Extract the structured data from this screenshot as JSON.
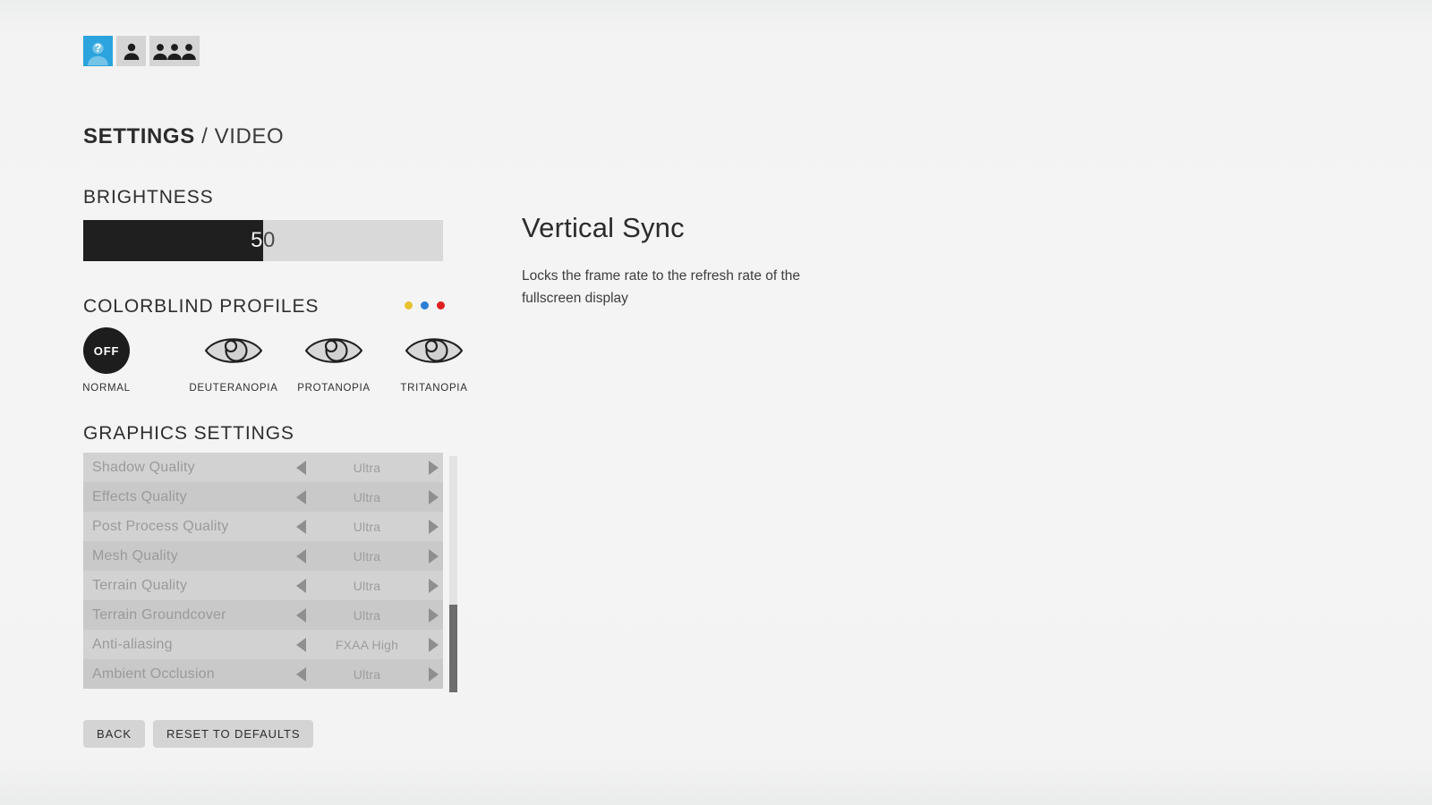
{
  "avatar_bar": {
    "tabs": [
      {
        "id": "profile-unknown",
        "icon": "person-question-icon",
        "active": true
      },
      {
        "id": "profile-single",
        "icon": "person-icon",
        "active": false
      },
      {
        "id": "profile-group",
        "icon": "people-group-icon",
        "active": false
      }
    ]
  },
  "header": {
    "title_strong": "SETTINGS",
    "title_separator": " / ",
    "title_light": "VIDEO"
  },
  "brightness": {
    "heading": "BRIGHTNESS",
    "value": 50,
    "value_label": "50",
    "min": 0,
    "max": 100,
    "fill_percent": 50,
    "fill_color": "#201f1f",
    "track_color": "#d9d9d9"
  },
  "colorblind": {
    "heading": "COLORBLIND PROFILES",
    "dots": [
      {
        "name": "dot-yellow",
        "color": "#e8c12e"
      },
      {
        "name": "dot-blue",
        "color": "#2b7fd4"
      },
      {
        "name": "dot-red",
        "color": "#e02020"
      }
    ],
    "profiles": [
      {
        "id": "normal",
        "label": "NORMAL",
        "badge": "OFF",
        "icon": "off-circle-icon",
        "selected": true
      },
      {
        "id": "deuteranopia",
        "label": "DEUTERANOPIA",
        "badge": "",
        "icon": "eye-icon",
        "selected": false
      },
      {
        "id": "protanopia",
        "label": "PROTANOPIA",
        "badge": "",
        "icon": "eye-icon",
        "selected": false
      },
      {
        "id": "tritanopia",
        "label": "TRITANOPIA",
        "badge": "",
        "icon": "eye-icon",
        "selected": false
      }
    ]
  },
  "graphics": {
    "heading": "GRAPHICS SETTINGS",
    "rows": [
      {
        "name": "Shadow Quality",
        "value": "Ultra"
      },
      {
        "name": "Effects Quality",
        "value": "Ultra"
      },
      {
        "name": "Post Process Quality",
        "value": "Ultra"
      },
      {
        "name": "Mesh Quality",
        "value": "Ultra"
      },
      {
        "name": "Terrain Quality",
        "value": "Ultra"
      },
      {
        "name": "Terrain Groundcover",
        "value": "Ultra"
      },
      {
        "name": "Anti-aliasing",
        "value": "FXAA High"
      },
      {
        "name": "Ambient Occlusion",
        "value": "Ultra"
      }
    ],
    "scrollbar": {
      "thumb_top_percent": 63,
      "thumb_height_percent": 37
    }
  },
  "buttons": {
    "back": "BACK",
    "reset": "RESET TO DEFAULTS"
  },
  "description": {
    "title": "Vertical Sync",
    "body": "Locks the frame rate to the refresh rate of the fullscreen display"
  }
}
